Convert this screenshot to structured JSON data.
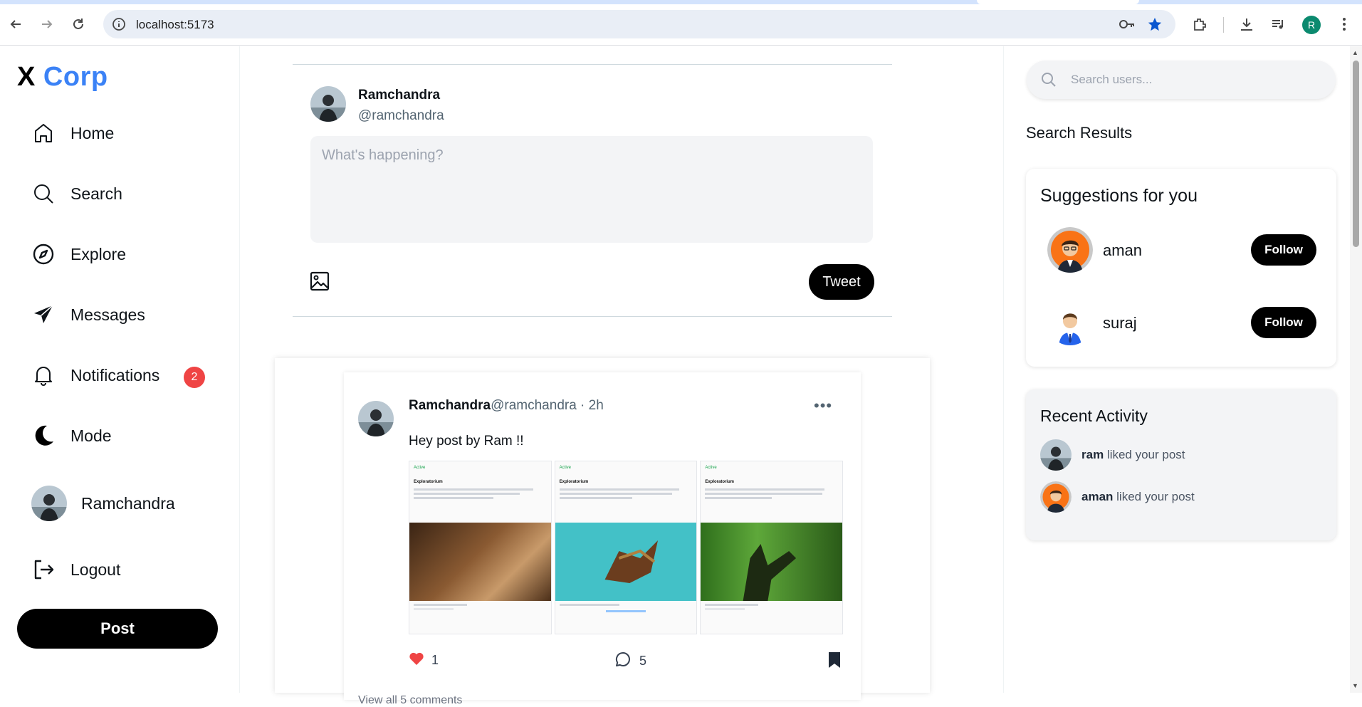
{
  "browser": {
    "url": "localhost:5173",
    "profile_initial": "R"
  },
  "sidebar": {
    "logo_x": "X",
    "logo_corp": "Corp",
    "items": [
      {
        "label": "Home",
        "icon": "home-icon"
      },
      {
        "label": "Search",
        "icon": "search-icon"
      },
      {
        "label": "Explore",
        "icon": "compass-icon"
      },
      {
        "label": "Messages",
        "icon": "send-icon"
      },
      {
        "label": "Notifications",
        "icon": "bell-icon"
      },
      {
        "label": "Mode",
        "icon": "moon-icon"
      },
      {
        "label": "Logout",
        "icon": "logout-icon"
      }
    ],
    "notifications_badge": "2",
    "profile_name": "Ramchandra",
    "post_label": "Post"
  },
  "composer": {
    "name": "Ramchandra",
    "handle": "@ramchandra",
    "placeholder": "What's happening?",
    "tweet_label": "Tweet"
  },
  "feed": {
    "post": {
      "name": "Ramchandra",
      "handle": "@ramchandra",
      "time": " · 2h",
      "more": "•••",
      "text": "Hey post by Ram !!",
      "likes": "1",
      "comments": "5",
      "view_all": "View all 5 comments"
    },
    "media_panels": [
      {
        "org": "Exploratorium",
        "status": "Active",
        "image_color": "#6b4a2e"
      },
      {
        "org": "Exploratorium",
        "status": "Active",
        "image_color": "#43c1c7"
      },
      {
        "org": "Exploratorium",
        "status": "Active",
        "image_color": "#4a8f2e"
      }
    ]
  },
  "right": {
    "search_placeholder": "Search users...",
    "search_results_title": "Search Results",
    "suggestions_title": "Suggestions for you",
    "suggestions": [
      {
        "name": "aman",
        "follow_label": "Follow"
      },
      {
        "name": "suraj",
        "follow_label": "Follow"
      }
    ],
    "recent_title": "Recent Activity",
    "recent": [
      {
        "user": "ram",
        "action": " liked your post"
      },
      {
        "user": "aman",
        "action": " liked your post"
      }
    ]
  },
  "colors": {
    "accent": "#3b82f6",
    "badge": "#ef4444",
    "like": "#ef4444",
    "button": "#000000"
  }
}
